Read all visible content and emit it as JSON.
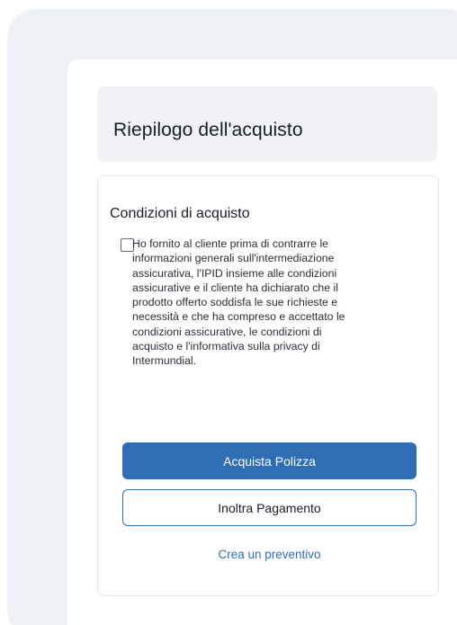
{
  "summary": {
    "title": "Riepilogo dell'acquisto"
  },
  "conditions": {
    "title": "Condizioni di acquisto",
    "checkbox_checked": false,
    "lines": [
      "Ho fornito al cliente prima di contrarre le",
      "informazioni generali sull'intermediazione",
      "assicurativa, l'IPID insieme alle condizioni",
      "assicurative e il cliente ha dichiarato che il",
      "prodotto offerto soddisfa le sue richieste e",
      "necessità e che ha compreso e accettato le",
      "condizioni assicurative, le condizioni di",
      "acquisto e l'informativa sulla privacy di",
      "Intermundial."
    ]
  },
  "actions": {
    "buy_label": "Acquista Polizza",
    "forward_label": "Inoltra Pagamento",
    "quote_label": "Crea un preventivo"
  },
  "colors": {
    "accent": "#2f6db5",
    "panel_bg": "#eef1f6",
    "header_bg": "#f1f2f6"
  }
}
